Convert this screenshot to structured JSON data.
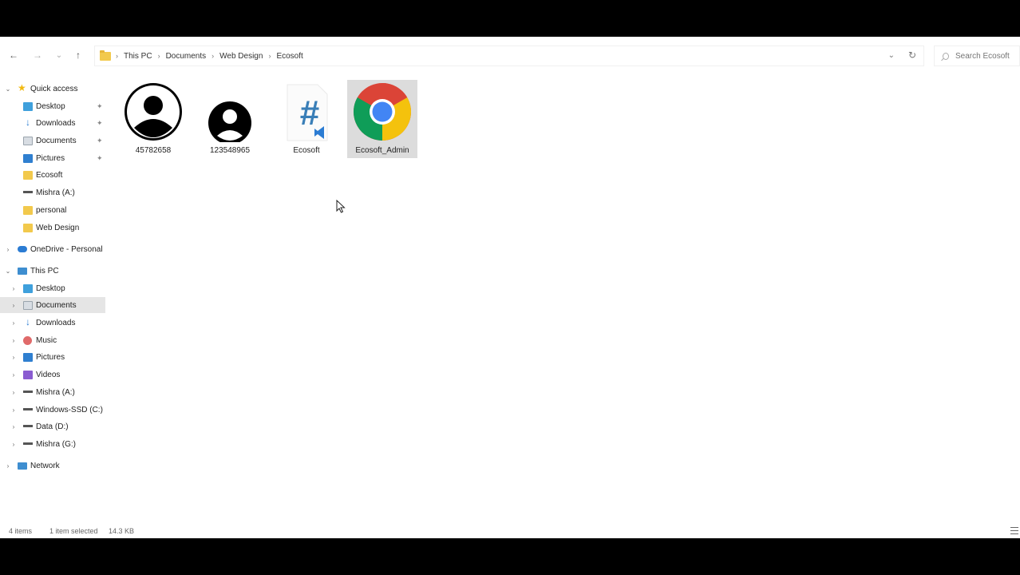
{
  "nav": {
    "back": "←",
    "forward": "→",
    "recent": "⌄",
    "up": "↑"
  },
  "breadcrumb": [
    "This PC",
    "Documents",
    "Web Design",
    "Ecosoft"
  ],
  "search": {
    "placeholder": "Search Ecosoft"
  },
  "sidebar": {
    "quick_access": "Quick access",
    "quick_items": [
      {
        "label": "Desktop",
        "icon": "desktop-icon",
        "pinned": true
      },
      {
        "label": "Downloads",
        "icon": "download-icon",
        "pinned": true
      },
      {
        "label": "Documents",
        "icon": "documents-icon",
        "pinned": true
      },
      {
        "label": "Pictures",
        "icon": "pictures-icon",
        "pinned": true
      },
      {
        "label": "Ecosoft",
        "icon": "folder-icon",
        "pinned": false
      },
      {
        "label": "Mishra (A:)",
        "icon": "drive-icon",
        "pinned": false
      },
      {
        "label": "personal",
        "icon": "folder-icon",
        "pinned": false
      },
      {
        "label": "Web Design",
        "icon": "folder-icon",
        "pinned": false
      }
    ],
    "onedrive": "OneDrive - Personal",
    "this_pc": "This PC",
    "pc_items": [
      {
        "label": "Desktop",
        "icon": "desktop-icon"
      },
      {
        "label": "Documents",
        "icon": "documents-icon",
        "selected": true
      },
      {
        "label": "Downloads",
        "icon": "download-icon"
      },
      {
        "label": "Music",
        "icon": "music-icon"
      },
      {
        "label": "Pictures",
        "icon": "pictures-icon"
      },
      {
        "label": "Videos",
        "icon": "videos-icon"
      },
      {
        "label": "Mishra (A:)",
        "icon": "drive-icon"
      },
      {
        "label": "Windows-SSD (C:)",
        "icon": "drive-icon"
      },
      {
        "label": "Data (D:)",
        "icon": "drive-icon"
      },
      {
        "label": "Mishra (G:)",
        "icon": "drive-icon"
      }
    ],
    "network": "Network"
  },
  "files": [
    {
      "name": "45782658",
      "icon": "user-avatar-icon"
    },
    {
      "name": "123548965",
      "icon": "user-avatar-icon"
    },
    {
      "name": "Ecosoft",
      "icon": "csharp-file-icon"
    },
    {
      "name": "Ecosoft_Admin",
      "icon": "chrome-icon",
      "selected": true
    }
  ],
  "status": {
    "count": "4 items",
    "selection": "1 item selected",
    "size": "14.3 KB"
  },
  "colors": {
    "selection": "#dcdcdc",
    "folder": "#f2c94c",
    "accent": "#2b7cd3"
  }
}
